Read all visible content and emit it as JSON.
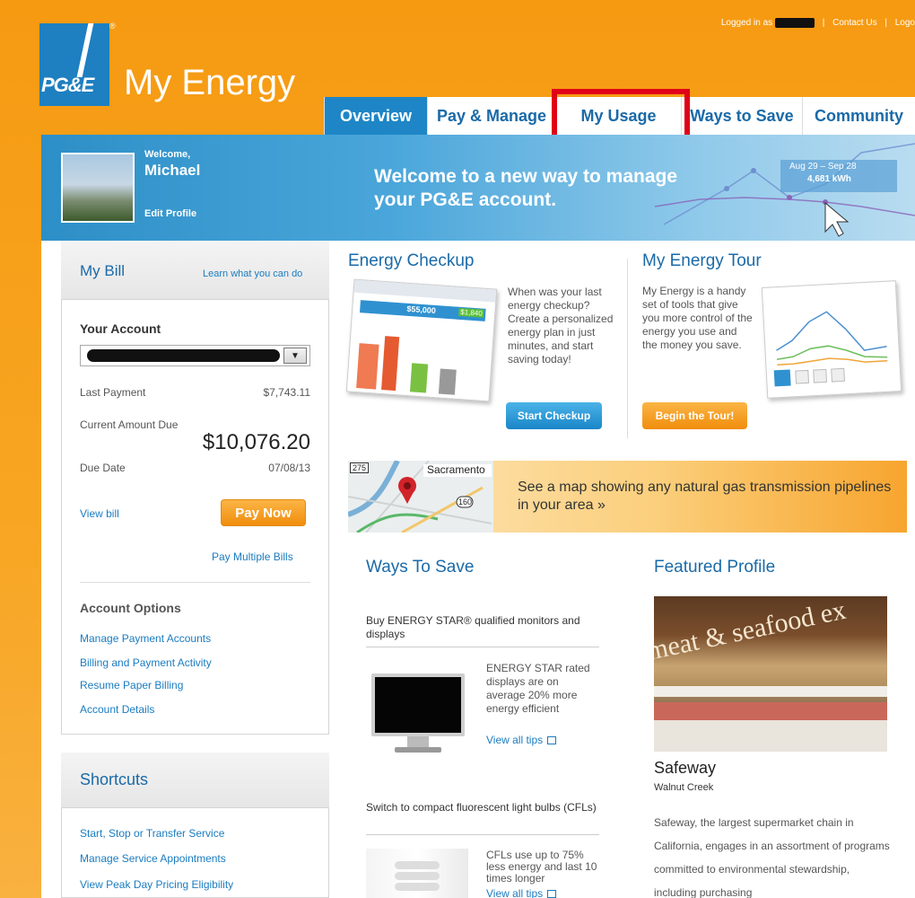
{
  "header": {
    "logo_text": "PG&E",
    "app_title": "My Energy",
    "logged_in_label": "Logged in as",
    "contact_link": "Contact Us",
    "logout_link": "Logo"
  },
  "tabs": [
    {
      "label": "Overview",
      "active": true
    },
    {
      "label": "Pay & Manage",
      "active": false
    },
    {
      "label": "My Usage",
      "active": false,
      "highlighted": true
    },
    {
      "label": "Ways to Save",
      "active": false
    },
    {
      "label": "Community",
      "active": false
    }
  ],
  "banner": {
    "welcome_label": "Welcome,",
    "user_name": "Michael",
    "edit_profile": "Edit Profile",
    "headline": "Welcome to a new way to manage your PG&E account.",
    "date_range": "Aug 29 – Sep 28",
    "kwh": "4,681 kWh"
  },
  "my_bill": {
    "title": "My Bill",
    "learn_link": "Learn what you can do",
    "your_account": "Your Account",
    "last_payment_label": "Last Payment",
    "last_payment_value": "$7,743.11",
    "current_due_label": "Current Amount Due",
    "current_due_value": "$10,076.20",
    "due_date_label": "Due Date",
    "due_date_value": "07/08/13",
    "view_bill": "View bill",
    "pay_now": "Pay Now",
    "pay_multiple": "Pay Multiple Bills",
    "account_options_title": "Account Options",
    "account_options": [
      "Manage Payment Accounts",
      "Billing and Payment Activity",
      "Resume Paper Billing",
      "Account Details"
    ]
  },
  "shortcuts": {
    "title": "Shortcuts",
    "items": [
      "Start, Stop or Transfer Service",
      "Manage Service Appointments",
      "View Peak Day Pricing Eligibility"
    ]
  },
  "energy_checkup": {
    "title": "Energy Checkup",
    "text": "When was your last energy checkup? Create a personalized energy plan in just minutes, and start saving today!",
    "button": "Start Checkup",
    "img_amount1": "$55,000",
    "img_amount2": "$1,840"
  },
  "energy_tour": {
    "title": "My Energy Tour",
    "text": "My Energy is a handy set of tools that give you more control of the energy you use and the money you save.",
    "button": "Begin the Tour!"
  },
  "map_promo": {
    "city": "Sacramento",
    "road1": "275",
    "road2": "160",
    "text": "See a map showing any natural gas transmission pipelines in your area »"
  },
  "ways_to_save": {
    "title": "Ways To Save",
    "tips": [
      {
        "title": "Buy ENERGY STAR® qualified monitors and displays",
        "description": "ENERGY STAR rated displays are on average 20% more energy efficient",
        "link": "View all tips"
      },
      {
        "title": "Switch to compact fluorescent light bulbs (CFLs)",
        "description": "CFLs use up to 75% less energy and last 10 times longer",
        "link": "View all tips"
      }
    ]
  },
  "featured_profile": {
    "title": "Featured Profile",
    "image_sign": "meat & seafood ex",
    "name": "Safeway",
    "location": "Walnut Creek",
    "description": "Safeway, the largest supermarket chain in California, engages in an assortment of programs committed to environmental stewardship, including purchasing"
  },
  "colors": {
    "brand_orange": "#f7a21b",
    "brand_blue": "#1e86c6",
    "link_blue": "#1a7cc0",
    "highlight_red": "#e00018"
  }
}
